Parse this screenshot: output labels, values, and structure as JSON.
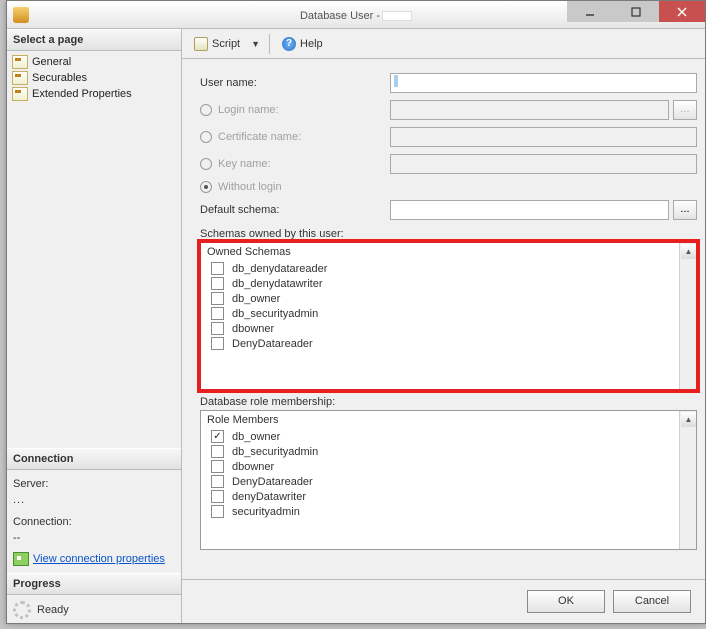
{
  "titlebar": {
    "title": "Database User -"
  },
  "left": {
    "select_page": "Select a page",
    "nav": [
      {
        "label": "General"
      },
      {
        "label": "Securables"
      },
      {
        "label": "Extended Properties"
      }
    ],
    "connection_head": "Connection",
    "server_label": "Server:",
    "server_value": "...",
    "conn_label": "Connection:",
    "conn_value": "--",
    "view_conn_props": "View connection properties",
    "progress_head": "Progress",
    "progress_status": "Ready"
  },
  "toolbar": {
    "script": "Script",
    "help": "Help"
  },
  "form": {
    "username_label": "User name:",
    "username_value": "",
    "loginname_label": "Login name:",
    "certname_label": "Certificate name:",
    "keyname_label": "Key name:",
    "withoutlogin_label": "Without login",
    "defaultschema_label": "Default schema:",
    "defaultschema_value": "",
    "more": "..."
  },
  "owned_schemas": {
    "section_label": "Schemas owned by this user:",
    "header": "Owned Schemas",
    "items": [
      {
        "label": "db_denydatareader",
        "checked": false
      },
      {
        "label": "db_denydatawriter",
        "checked": false
      },
      {
        "label": "db_owner",
        "checked": false
      },
      {
        "label": "db_securityadmin",
        "checked": false
      },
      {
        "label": "dbowner",
        "checked": false
      },
      {
        "label": "DenyDatareader",
        "checked": false
      }
    ]
  },
  "role_membership": {
    "section_label": "Database role membership:",
    "header": "Role Members",
    "items": [
      {
        "label": "db_owner",
        "checked": true
      },
      {
        "label": "db_securityadmin",
        "checked": false
      },
      {
        "label": "dbowner",
        "checked": false
      },
      {
        "label": "DenyDatareader",
        "checked": false
      },
      {
        "label": "denyDatawriter",
        "checked": false
      },
      {
        "label": "securityadmin",
        "checked": false
      }
    ]
  },
  "footer": {
    "ok": "OK",
    "cancel": "Cancel"
  }
}
